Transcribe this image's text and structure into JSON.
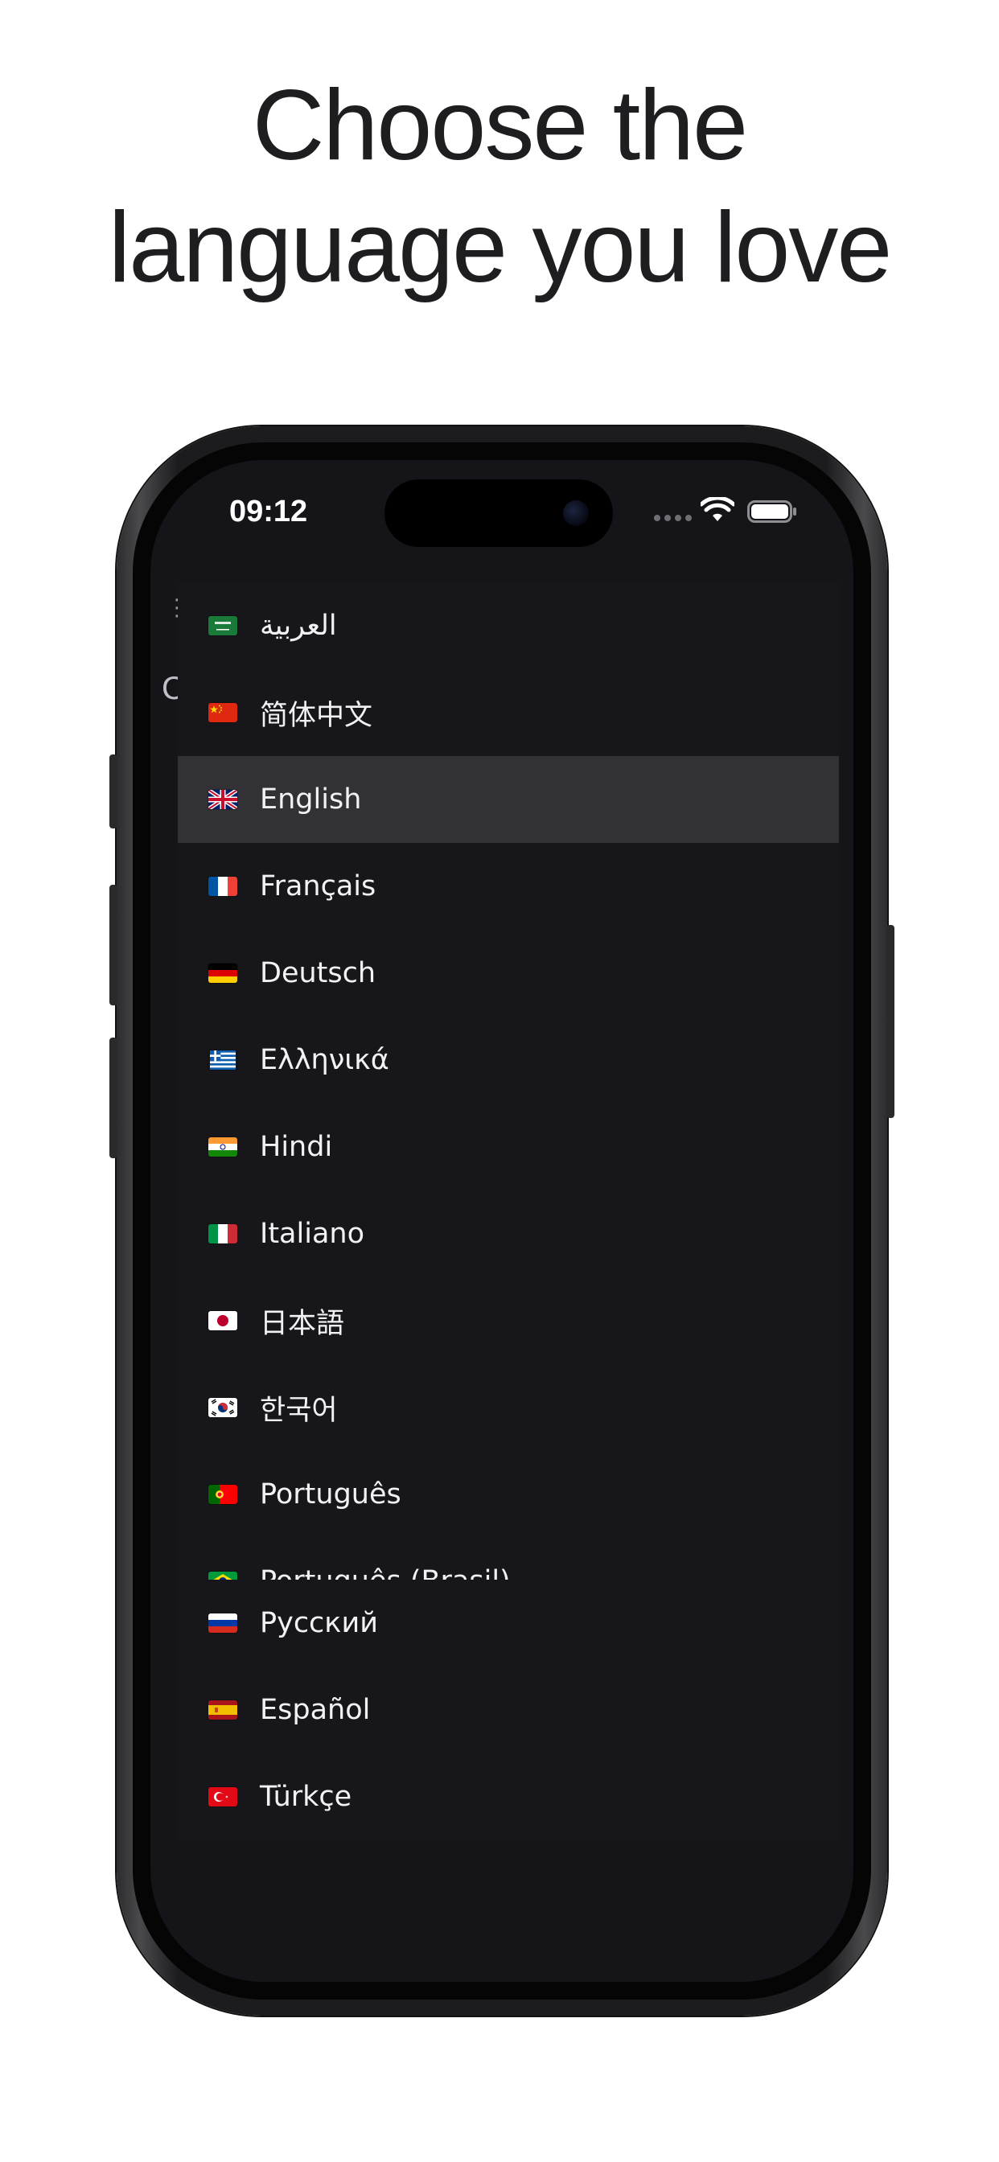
{
  "headline": {
    "line1": "Choose the",
    "line2": "language you love"
  },
  "status_bar": {
    "time": "09:12",
    "icons": [
      "signal-dots-icon",
      "wifi-icon",
      "battery-icon"
    ]
  },
  "menu": {
    "selected_index": 2,
    "items": [
      {
        "label": "العربية",
        "flag": "saudi-arabia-flag-icon"
      },
      {
        "label": "简体中文",
        "flag": "china-flag-icon"
      },
      {
        "label": "English",
        "flag": "united-kingdom-flag-icon"
      },
      {
        "label": "Français",
        "flag": "france-flag-icon"
      },
      {
        "label": "Deutsch",
        "flag": "germany-flag-icon"
      },
      {
        "label": "Ελληνικά",
        "flag": "greece-flag-icon"
      },
      {
        "label": "Hindi",
        "flag": "india-flag-icon"
      },
      {
        "label": "Italiano",
        "flag": "italy-flag-icon"
      },
      {
        "label": "日本語",
        "flag": "japan-flag-icon"
      },
      {
        "label": "한국어",
        "flag": "south-korea-flag-icon"
      },
      {
        "label": "Português",
        "flag": "portugal-flag-icon"
      },
      {
        "label": "Português (Brasil)",
        "flag": "brazil-flag-icon"
      },
      {
        "label": "Русский",
        "flag": "russia-flag-icon"
      },
      {
        "label": "Español",
        "flag": "spain-flag-icon"
      },
      {
        "label": "Türkçe",
        "flag": "turkey-flag-icon"
      }
    ]
  },
  "colors": {
    "menu_background": "#17171b",
    "selected_row": "#323236",
    "screen_background": "#151519",
    "headline_text": "#1e1e20"
  }
}
